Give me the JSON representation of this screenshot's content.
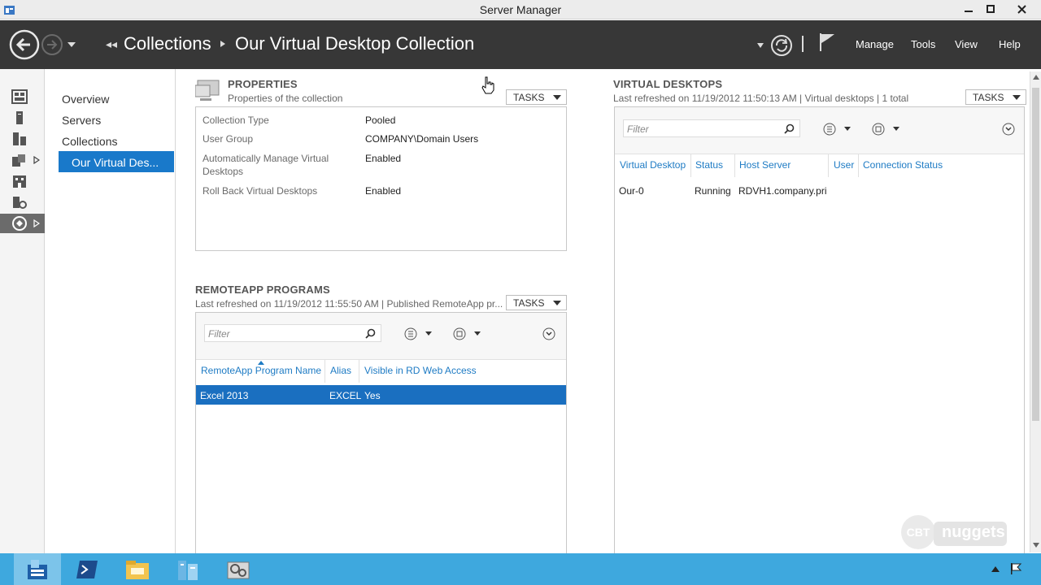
{
  "window": {
    "title": "Server Manager"
  },
  "header": {
    "breadcrumb_root": "Collections",
    "breadcrumb_current": "Our Virtual Desktop Collection",
    "menus": [
      "Manage",
      "Tools",
      "View",
      "Help"
    ]
  },
  "rail": {
    "icons": [
      "dashboard-icon",
      "local-server-icon",
      "all-servers-icon",
      "file-storage-icon",
      "iis-icon",
      "rds-icon",
      "remote-desktop-services-icon"
    ]
  },
  "nav": {
    "items": [
      "Overview",
      "Servers",
      "Collections",
      "Our Virtual Des..."
    ]
  },
  "properties": {
    "title": "PROPERTIES",
    "subtitle": "Properties of the collection",
    "tasks_label": "TASKS",
    "rows": [
      {
        "label": "Collection Type",
        "value": "Pooled"
      },
      {
        "label": "User Group",
        "value": "COMPANY\\Domain Users"
      },
      {
        "label": "Automatically Manage Virtual Desktops",
        "value": "Enabled"
      },
      {
        "label": "Roll Back Virtual Desktops",
        "value": "Enabled"
      }
    ]
  },
  "remoteapp": {
    "title": "REMOTEAPP PROGRAMS",
    "subtitle": "Last refreshed on 11/19/2012 11:55:50 AM | Published RemoteApp pr...",
    "tasks_label": "TASKS",
    "filter_placeholder": "Filter",
    "columns": [
      "RemoteApp Program Name",
      "Alias",
      "Visible in RD Web Access"
    ],
    "rows": [
      {
        "name": "Excel 2013",
        "alias": "EXCEL",
        "visible": "Yes"
      }
    ]
  },
  "virtual_desktops": {
    "title": "VIRTUAL DESKTOPS",
    "subtitle": "Last refreshed on 11/19/2012 11:50:13 AM | Virtual desktops  | 1 total",
    "tasks_label": "TASKS",
    "filter_placeholder": "Filter",
    "columns": [
      "Virtual Desktop",
      "Status",
      "Host Server",
      "User",
      "Connection Status"
    ],
    "rows": [
      {
        "desktop": "Our-0",
        "status": "Running",
        "host": "RDVH1.company.pri",
        "user": "",
        "connection": ""
      }
    ]
  },
  "watermark": {
    "brand_left": "CBT",
    "brand_right": "nuggets"
  },
  "colors": {
    "header_bg": "#373737",
    "selection": "#1979ca",
    "taskbar": "#3ea8de",
    "link": "#1e7bc4"
  }
}
